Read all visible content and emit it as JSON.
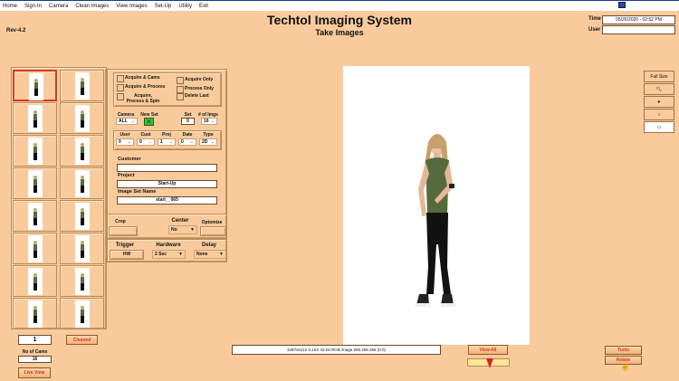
{
  "menu": [
    "Home",
    "Sign-In",
    "Camera",
    "Clean Images",
    "View Images",
    "Set-Up",
    "Utility",
    "Exit"
  ],
  "header": {
    "title": "Techtol Imaging System",
    "subtitle": "Take Images",
    "version": "Rev-4.2",
    "time_label": "Time",
    "time_value": "05/26/2020 - 02:52 PM",
    "user_label": "User",
    "user_value": ""
  },
  "thumbnails": {
    "count": 16,
    "selected": 0
  },
  "panel": {
    "checkboxes_left": [
      "Acquire & Cams",
      "Acquire & Process",
      "Acquire, Process & Spin"
    ],
    "checkboxes_right": [
      "Acquire Only",
      "Process Only",
      "Delete Last"
    ],
    "camera_label": "Camera",
    "camera_value": "ALL",
    "new_set_label": "New Set",
    "set_label": "Set",
    "set_value": "0",
    "imgs_label": "# of Imgs",
    "imgs_value": "16",
    "user_label": "User",
    "user_value": "0",
    "cust_label": "Cust",
    "cust_value": "0",
    "proj_label": "Proj",
    "proj_value": "1",
    "date_label": "Date",
    "date_value": "0",
    "type_label": "Type",
    "type_value": "2D",
    "customer_label": "Customer",
    "customer_value": "",
    "project_label": "Project",
    "project_value": "Start-Up",
    "imageset_label": "Image Set Name",
    "imageset_value": "start__065",
    "crop_label": "Crop",
    "center_label": "Center",
    "center_value": "No",
    "optimize_label": "Optomize",
    "trigger_label": "Trigger",
    "trigger_value": "HW",
    "hardware_label": "Hardware",
    "hardware_value": "2 Sec",
    "delay_label": "Delay",
    "delay_value": "None"
  },
  "bottom_left": {
    "counter": "1",
    "cleaned": "Cleaned",
    "no_cams_label": "No of Cams",
    "no_cams_value": "16",
    "live_view": "Live View"
  },
  "status_text": "3497x5212 0.15X 32-bit RGB image 255.255.255    (0.0)",
  "view_all": "View All",
  "slider_position": 0.5,
  "tools": {
    "full_size": "Full Size",
    "tools": "Tools",
    "rotate": "Rotate"
  }
}
